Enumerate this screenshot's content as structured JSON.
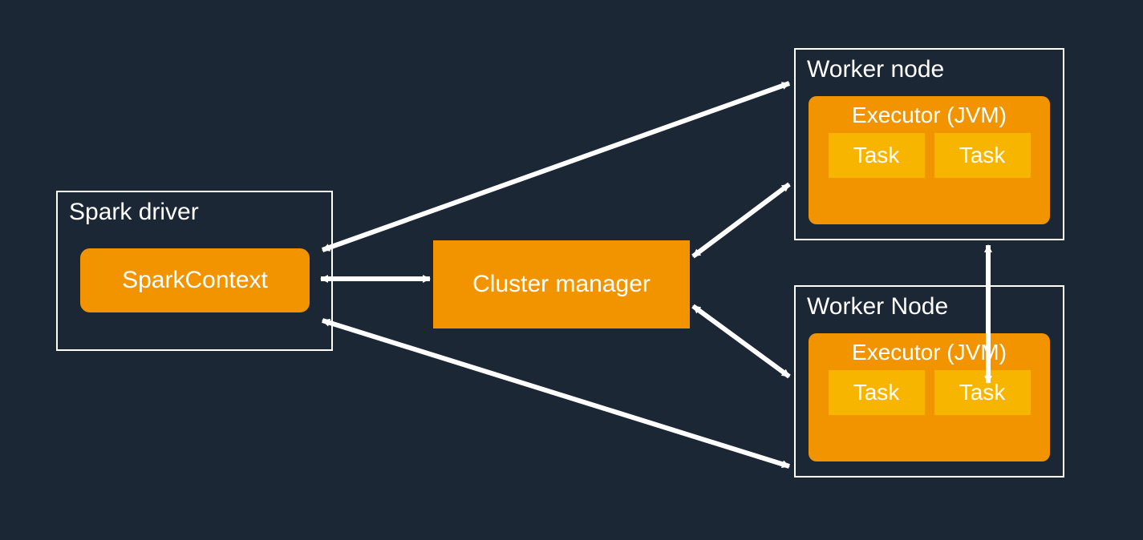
{
  "colors": {
    "bg": "#1b2735",
    "panel_border": "#ffffff",
    "primary": "#f29400",
    "task": "#f7b500",
    "text": "#ffffff",
    "arrow": "#ffffff"
  },
  "driver": {
    "panel_label": "Spark driver",
    "context_label": "SparkContext"
  },
  "cluster_manager": {
    "label": "Cluster manager"
  },
  "worker_top": {
    "panel_label": "Worker node",
    "executor_label": "Executor (JVM)",
    "tasks": [
      "Task",
      "Task"
    ]
  },
  "worker_bottom": {
    "panel_label": "Worker Node",
    "executor_label": "Executor (JVM)",
    "tasks": [
      "Task",
      "Task"
    ]
  },
  "connections": [
    {
      "from": "SparkContext",
      "to": "Cluster manager",
      "type": "bidirectional"
    },
    {
      "from": "SparkContext",
      "to": "Worker node (top)",
      "type": "bidirectional"
    },
    {
      "from": "SparkContext",
      "to": "Worker Node (bottom)",
      "type": "bidirectional"
    },
    {
      "from": "Cluster manager",
      "to": "Worker node (top)",
      "type": "bidirectional"
    },
    {
      "from": "Cluster manager",
      "to": "Worker Node (bottom)",
      "type": "bidirectional"
    },
    {
      "from": "Worker node (top)",
      "to": "Worker Node (bottom)",
      "type": "bidirectional"
    }
  ]
}
